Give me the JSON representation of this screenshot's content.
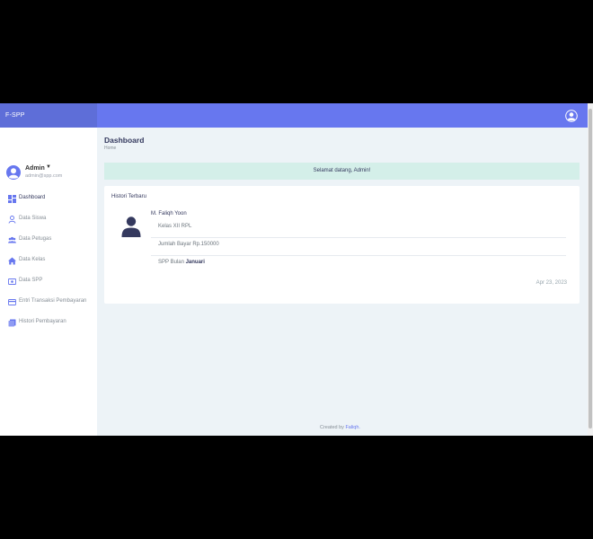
{
  "brand": "F-SPP",
  "profile": {
    "name": "Admin",
    "email": "admin@spp.com"
  },
  "sidebar": {
    "items": [
      {
        "label": "Dashboard",
        "icon": "dashboard-icon"
      },
      {
        "label": "Data Siswa",
        "icon": "user-icon"
      },
      {
        "label": "Data Petugas",
        "icon": "users-icon"
      },
      {
        "label": "Data Kelas",
        "icon": "home-icon"
      },
      {
        "label": "Data SPP",
        "icon": "money-icon"
      },
      {
        "label": "Entri Transaksi Pembayaran",
        "icon": "credit-card-icon"
      },
      {
        "label": "Histori Pembayaran",
        "icon": "history-icon"
      }
    ]
  },
  "page": {
    "title": "Dashboard",
    "breadcrumb": "Home"
  },
  "alert": "Selamat datang, Admin!",
  "history": {
    "title": "Histori Terbaru",
    "name": "M. Faliqh Yoon",
    "kelas": "Kelas XII RPL",
    "jumlah": "Jumlah Bayar Rp.150000",
    "spp_prefix": "SPP Bulan ",
    "spp_month": "Januari",
    "date": "Apr 23, 2023"
  },
  "footer": {
    "text": "Created by ",
    "link": "Faliqh."
  },
  "colors": {
    "primary": "#6777ef",
    "alert_bg": "#d4efe9",
    "background": "#edf3f7"
  }
}
